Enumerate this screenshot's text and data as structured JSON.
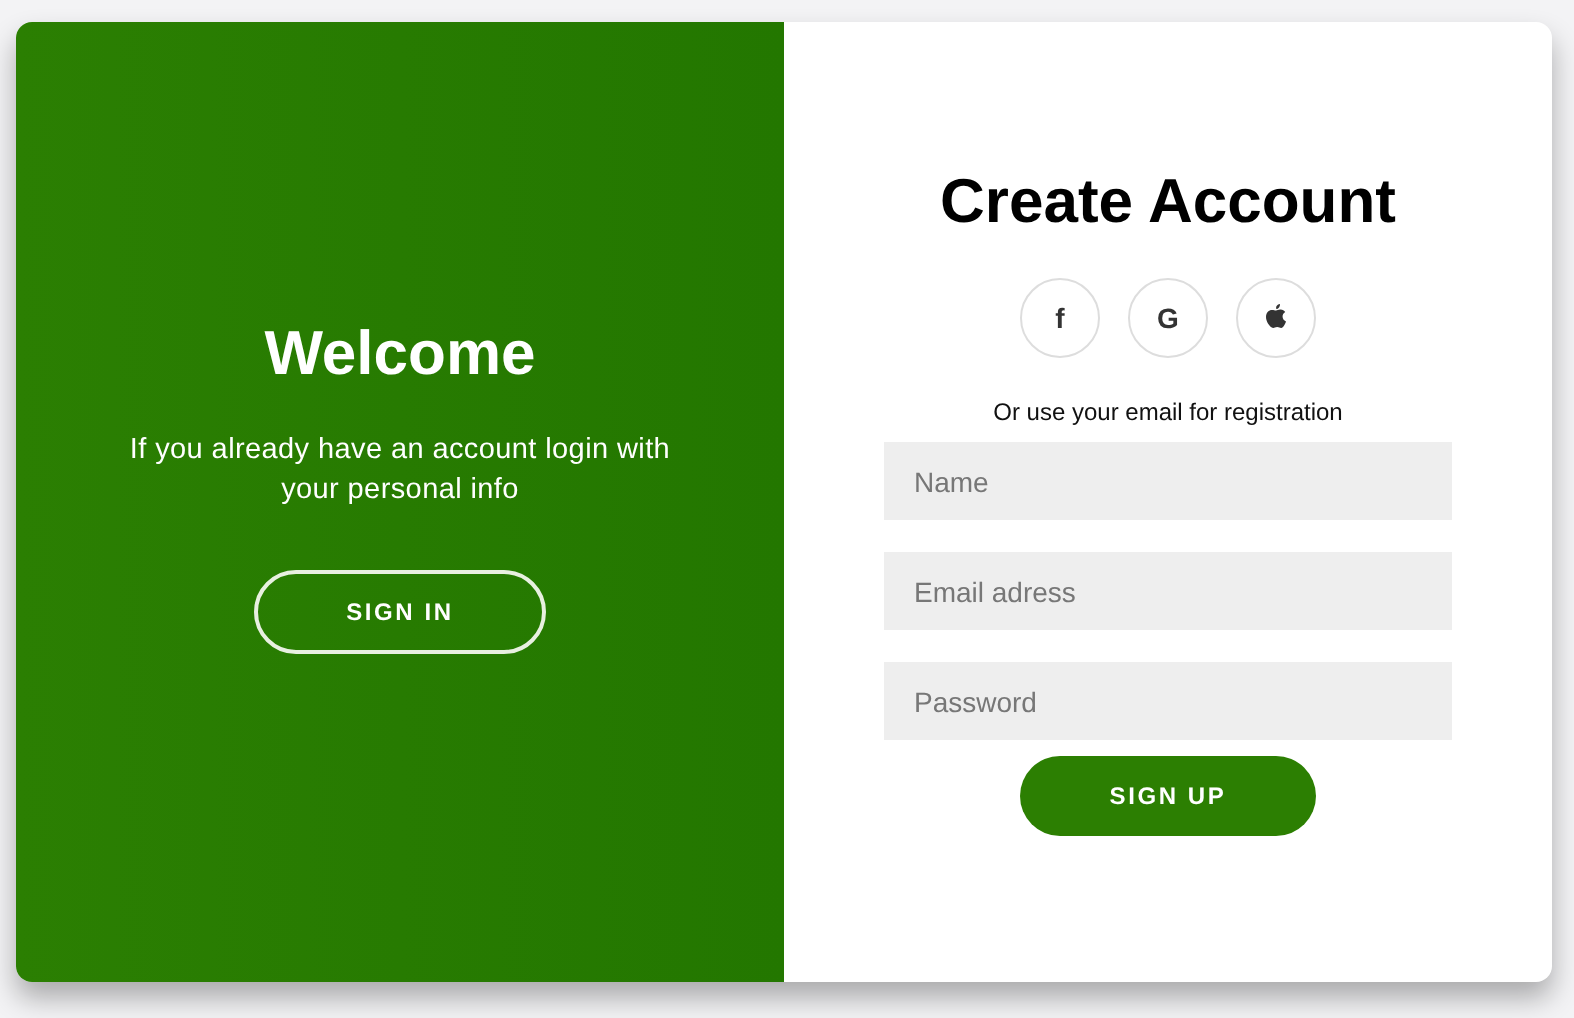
{
  "welcome_panel": {
    "title": "Welcome",
    "text": "If you already have an account login with your personal info",
    "button": "SIGN IN"
  },
  "signup_panel": {
    "title": "Create Account",
    "social_buttons": [
      {
        "kind": "text",
        "label": "f"
      },
      {
        "kind": "text",
        "label": "G"
      },
      {
        "kind": "apple"
      }
    ],
    "hint": "Or use your email for registration",
    "fields": [
      {
        "placeholder": "Name"
      },
      {
        "placeholder": "Email adress"
      },
      {
        "placeholder": "Password"
      }
    ],
    "button": "SIGN UP"
  }
}
